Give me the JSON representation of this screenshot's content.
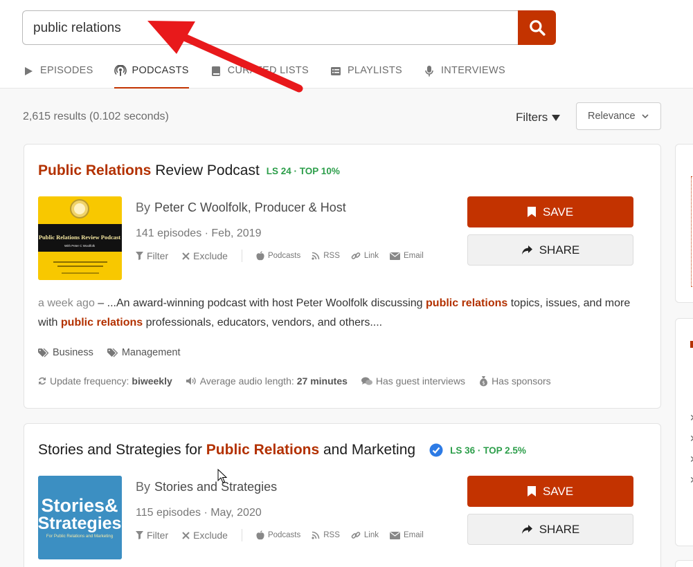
{
  "search": {
    "value": "public relations",
    "button_icon": "search-icon"
  },
  "tabs": [
    {
      "label": "EPISODES",
      "icon": "play-icon"
    },
    {
      "label": "PODCASTS",
      "icon": "podcast-icon",
      "active": true
    },
    {
      "label": "CURATED LISTS",
      "icon": "book-icon"
    },
    {
      "label": "PLAYLISTS",
      "icon": "list-icon"
    },
    {
      "label": "INTERVIEWS",
      "icon": "microphone-icon"
    }
  ],
  "results": {
    "count_text": "2,615 results (0.102 seconds)",
    "filters_label": "Filters",
    "sort_value": "Relevance"
  },
  "cards": [
    {
      "title_highlight": "Public Relations",
      "title_rest": " Review Podcast",
      "ls": "LS 24 · TOP 10%",
      "artwork_title": "Public Relations Review Podcast",
      "artwork_subtitle": "With Peter C Woolfolk",
      "by_label": "By",
      "author": "Peter C Woolfolk, Producer & Host",
      "meta": "141 episodes · Feb, 2019",
      "actions": {
        "filter": "Filter",
        "exclude": "Exclude",
        "podcasts": "Podcasts",
        "rss": "RSS",
        "link": "Link",
        "email": "Email"
      },
      "save_label": "SAVE",
      "share_label": "SHARE",
      "desc": {
        "ago": "a week ago",
        "dash": " – ",
        "part1": "...An award-winning podcast with host Peter Woolfolk discussing ",
        "hl1": "public relations",
        "part2": " topics, issues, and more with ",
        "hl2": "public relations",
        "part3": " professionals, educators, vendors, and others...."
      },
      "categories": [
        "Business",
        "Management"
      ],
      "stats": {
        "freq_label": "Update frequency:",
        "freq_value": "biweekly",
        "length_label": "Average audio length:",
        "length_value": "27 minutes",
        "guests": "Has guest interviews",
        "sponsors": "Has sponsors"
      }
    },
    {
      "title_prefix": "Stories and Strategies for ",
      "title_highlight": "Public Relations",
      "title_rest": " and Marketing",
      "ls": "LS 36 · TOP 2.5%",
      "artwork_line1": "Stories&",
      "artwork_line2": "Strategies",
      "artwork_line3": "For Public Relations and Marketing",
      "by_label": "By",
      "author": "Stories and Strategies",
      "meta": "115 episodes · May, 2020",
      "actions": {
        "filter": "Filter",
        "exclude": "Exclude",
        "podcasts": "Podcasts",
        "rss": "RSS",
        "link": "Link",
        "email": "Email"
      },
      "save_label": "SAVE",
      "share_label": "SHARE"
    }
  ],
  "colors": {
    "accent": "#c33300",
    "highlight": "#b33100",
    "ls_green": "#2c9e4a",
    "annotation_arrow": "#e8191b"
  }
}
